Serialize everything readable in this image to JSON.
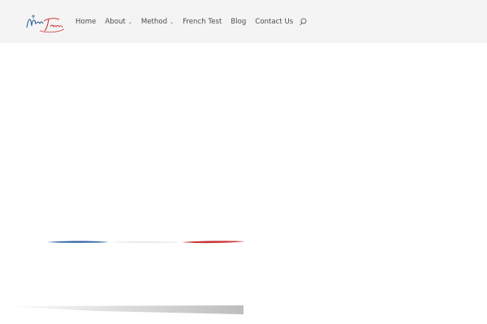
{
  "header": {
    "logo": {
      "icon": "napoli-french-logo-icon",
      "top_word": "Napoli",
      "bottom_word": "French",
      "colors": {
        "blue": "#2f5c9c",
        "red": "#cc3b3b"
      }
    },
    "nav": [
      {
        "label": "Home",
        "has_dropdown": false
      },
      {
        "label": "About",
        "has_dropdown": true
      },
      {
        "label": "Method",
        "has_dropdown": true
      },
      {
        "label": "French Test",
        "has_dropdown": false
      },
      {
        "label": "Blog",
        "has_dropdown": false
      },
      {
        "label": "Contact Us",
        "has_dropdown": false
      }
    ],
    "dropdown_glyph": "⌄",
    "search_icon": "search-icon"
  },
  "decor": {
    "flag_stripe_colors": [
      "#2f63a6",
      "#e6e6e6",
      "#c8373a"
    ]
  }
}
